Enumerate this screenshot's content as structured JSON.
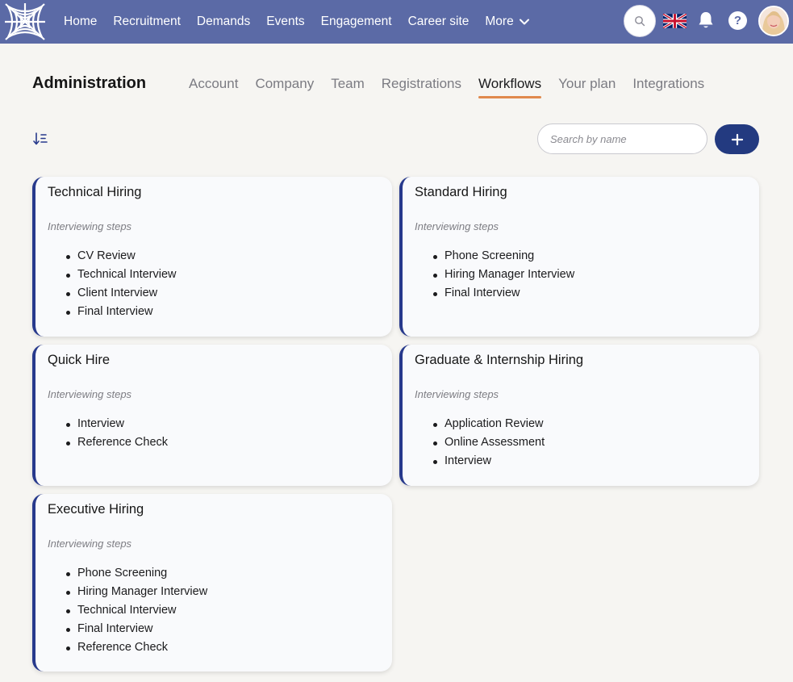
{
  "nav": {
    "items": [
      {
        "label": "Home"
      },
      {
        "label": "Recruitment"
      },
      {
        "label": "Demands"
      },
      {
        "label": "Events"
      },
      {
        "label": "Engagement"
      },
      {
        "label": "Career site"
      },
      {
        "label": "More"
      }
    ]
  },
  "page": {
    "title": "Administration"
  },
  "tabs": [
    {
      "label": "Account"
    },
    {
      "label": "Company"
    },
    {
      "label": "Team"
    },
    {
      "label": "Registrations"
    },
    {
      "label": "Workflows",
      "active": true
    },
    {
      "label": "Your plan"
    },
    {
      "label": "Integrations"
    }
  ],
  "toolbar": {
    "search_placeholder": "Search by name",
    "add_label": "+"
  },
  "cards": [
    {
      "title": "Technical Hiring",
      "subtitle": "Interviewing steps",
      "steps": [
        "CV Review",
        "Technical Interview",
        "Client Interview",
        "Final Interview"
      ]
    },
    {
      "title": "Standard Hiring",
      "subtitle": "Interviewing steps",
      "steps": [
        "Phone Screening",
        "Hiring Manager Interview",
        "Final Interview"
      ]
    },
    {
      "title": "Quick Hire",
      "subtitle": "Interviewing steps",
      "steps": [
        "Interview",
        "Reference Check"
      ]
    },
    {
      "title": "Graduate & Internship Hiring",
      "subtitle": "Interviewing steps",
      "steps": [
        "Application Review",
        "Online Assessment",
        "Interview"
      ]
    },
    {
      "title": "Executive Hiring",
      "subtitle": "Interviewing steps",
      "steps": [
        "Phone Screening",
        "Hiring Manager Interview",
        "Technical Interview",
        "Final Interview",
        "Reference Check"
      ]
    }
  ],
  "colors": {
    "topbar": "#5b6aa6",
    "accent": "#27398c",
    "tab_underline": "#e0894d",
    "add_button": "#233a80"
  },
  "icons": {
    "logo": "spider-web-logo",
    "search": "search-icon",
    "flag": "uk-flag-icon",
    "bell": "bell-icon",
    "help": "help-icon",
    "sort": "sort-icon",
    "more": "chevron-down-icon"
  }
}
